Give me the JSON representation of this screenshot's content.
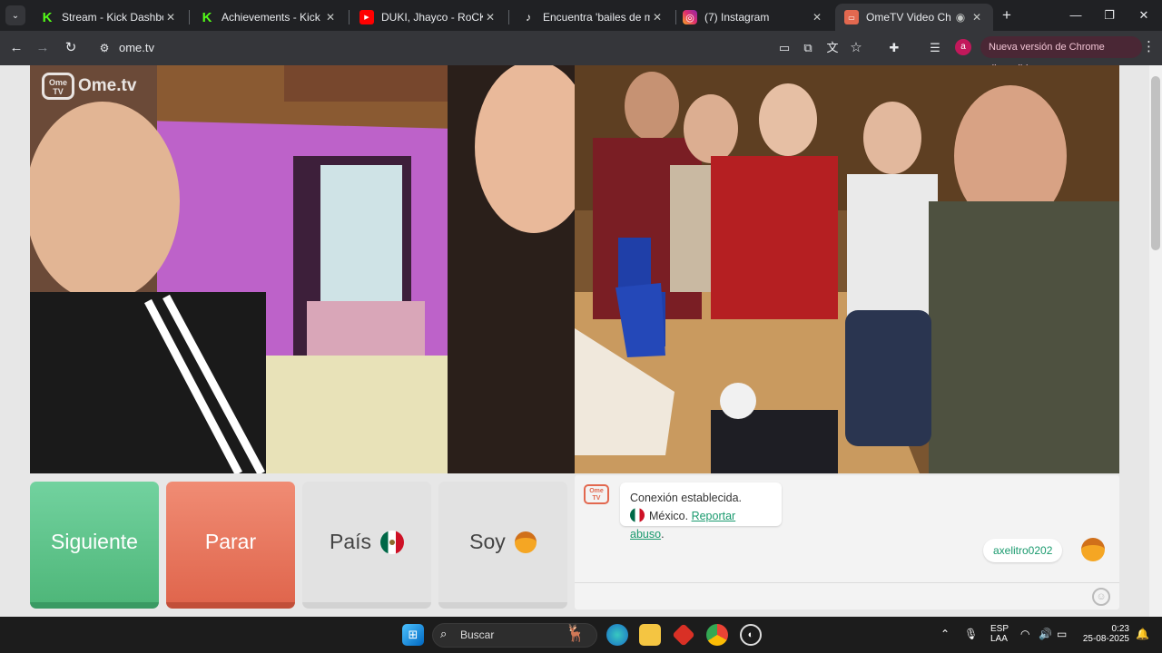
{
  "tabs": [
    {
      "title": "Stream - Kick Dashboard",
      "favicon": "K",
      "color": "#53fc18"
    },
    {
      "title": "Achievements - Kick Dashb",
      "favicon": "K",
      "color": "#53fc18"
    },
    {
      "title": "DUKI, Jhayco - RoCKSTAR",
      "favicon": "▶",
      "color": "#ff0000"
    },
    {
      "title": "Encuentra 'bailes de motin",
      "favicon": "♪",
      "color": "#ffffff"
    },
    {
      "title": "(7) Instagram",
      "favicon": "◎",
      "color": "#e1306c"
    },
    {
      "title": "OmeTV Video Chat —",
      "favicon": "▭",
      "color": "#e2684f"
    }
  ],
  "toolbar": {
    "url": "ome.tv",
    "profile_initial": "a",
    "update_label": "Nueva versión de Chrome disponible"
  },
  "logo": {
    "badge": "Ome TV",
    "wordmark": "Ome.tv"
  },
  "controls": {
    "next": "Siguiente",
    "stop": "Parar",
    "country": "País",
    "gender": "Soy"
  },
  "chat": {
    "badge": "Ome TV",
    "status": "Conexión establecida.",
    "country": "México.",
    "report": "Reportar abuso",
    "report_suffix": ".",
    "username": "axelitro0202"
  },
  "taskbar": {
    "search_placeholder": "Buscar",
    "language_1": "ESP",
    "language_2": "LAA",
    "time": "0:23",
    "date": "25-08-2025"
  }
}
